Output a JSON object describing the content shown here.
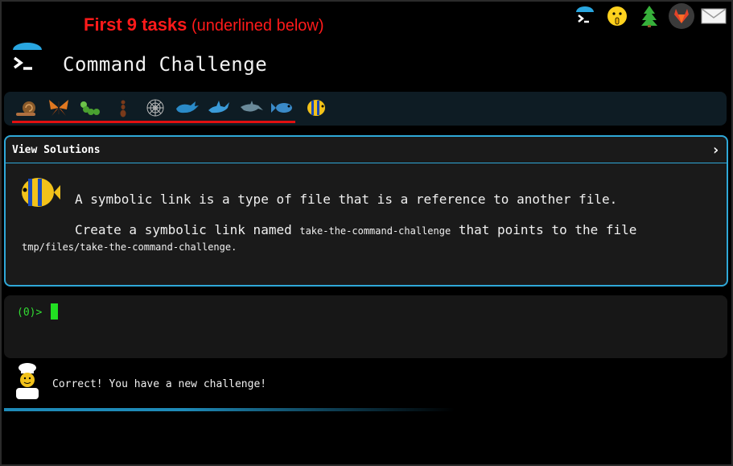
{
  "overlay": {
    "bold": "First 9 tasks",
    "rest": " (underlined below)"
  },
  "header": {
    "title": "Command Challenge"
  },
  "top_icons": [
    "terminal-icon",
    "shushing-face-icon",
    "tree-icon",
    "gitlab-icon",
    "mail-icon"
  ],
  "animals": [
    "snail",
    "butterfly",
    "caterpillar",
    "ant",
    "spider-web",
    "whale",
    "shark",
    "dolphin",
    "fish",
    "tropical-fish"
  ],
  "panel": {
    "header": "View Solutions",
    "chevron": "›",
    "line1": "A symbolic link is a type of file that is a reference to another file.",
    "line2_prefix": "Create a symbolic link named ",
    "line2_code": "take-the-command-challenge",
    "line2_suffix": " that points to the file",
    "line3": "tmp/files/take-the-command-challenge."
  },
  "terminal": {
    "prompt": "(0)>"
  },
  "status": {
    "text": "Correct! You have a new challenge!"
  },
  "colors": {
    "accent": "#2fa8d8",
    "overlay_red": "#ff1a1a",
    "prompt_green": "#33dd33"
  }
}
